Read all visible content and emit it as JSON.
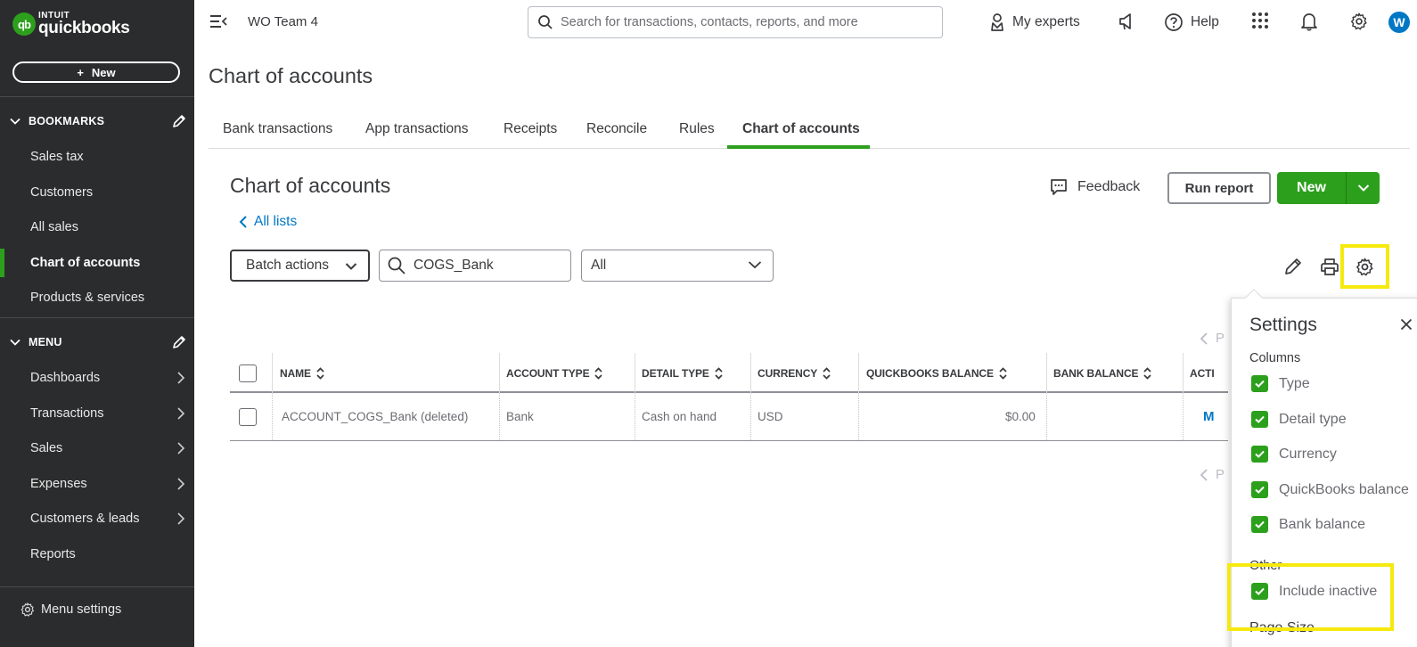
{
  "sidebar": {
    "logo_top": "INTUIT",
    "logo_bottom": "quickbooks",
    "logo_mark": "qb",
    "new_button": "New",
    "bookmarks_label": "BOOKMARKS",
    "bookmarks": [
      "Sales tax",
      "Customers",
      "All sales",
      "Chart of accounts",
      "Products & services"
    ],
    "active_item": "Chart of accounts",
    "menu_label": "MENU",
    "menu": [
      "Dashboards",
      "Transactions",
      "Sales",
      "Expenses",
      "Customers & leads",
      "Reports"
    ],
    "menu_settings": "Menu settings"
  },
  "topbar": {
    "company": "WO Team 4",
    "search_placeholder": "Search for transactions, contacts, reports, and more",
    "my_experts": "My experts",
    "help": "Help",
    "avatar_letter": "W"
  },
  "page": {
    "title": "Chart of accounts",
    "tabs": [
      "Bank transactions",
      "App transactions",
      "Receipts",
      "Reconcile",
      "Rules",
      "Chart of accounts"
    ],
    "active_tab": "Chart of accounts",
    "subtitle": "Chart of accounts",
    "all_lists": "All lists",
    "feedback": "Feedback",
    "run_report": "Run report",
    "new_button": "New",
    "batch_actions": "Batch actions",
    "filter_value": "COGS_Bank",
    "filter_select": "All"
  },
  "table": {
    "headers": [
      "NAME",
      "ACCOUNT TYPE",
      "DETAIL TYPE",
      "CURRENCY",
      "QUICKBOOKS BALANCE",
      "BANK BALANCE",
      "ACTI"
    ],
    "rows": [
      {
        "name": "ACCOUNT_COGS_Bank (deleted)",
        "account_type": "Bank",
        "detail_type": "Cash on hand",
        "currency": "USD",
        "quickbooks_balance": "$0.00",
        "bank_balance": "",
        "action": "M"
      }
    ],
    "pager_top": "P",
    "pager_bottom": "P"
  },
  "settings_panel": {
    "title": "Settings",
    "columns_label": "Columns",
    "columns": [
      {
        "label": "Type",
        "checked": true
      },
      {
        "label": "Detail type",
        "checked": true
      },
      {
        "label": "Currency",
        "checked": true
      },
      {
        "label": "QuickBooks balance",
        "checked": true
      },
      {
        "label": "Bank balance",
        "checked": true
      }
    ],
    "other_label": "Other",
    "include_inactive": {
      "label": "Include inactive",
      "checked": true
    },
    "page_size_label": "Page Size"
  },
  "colors": {
    "brand_green": "#2ca01c",
    "link_blue": "#0077c5",
    "sidebar_bg": "#2b2c2d",
    "highlight": "#f5e90e"
  }
}
